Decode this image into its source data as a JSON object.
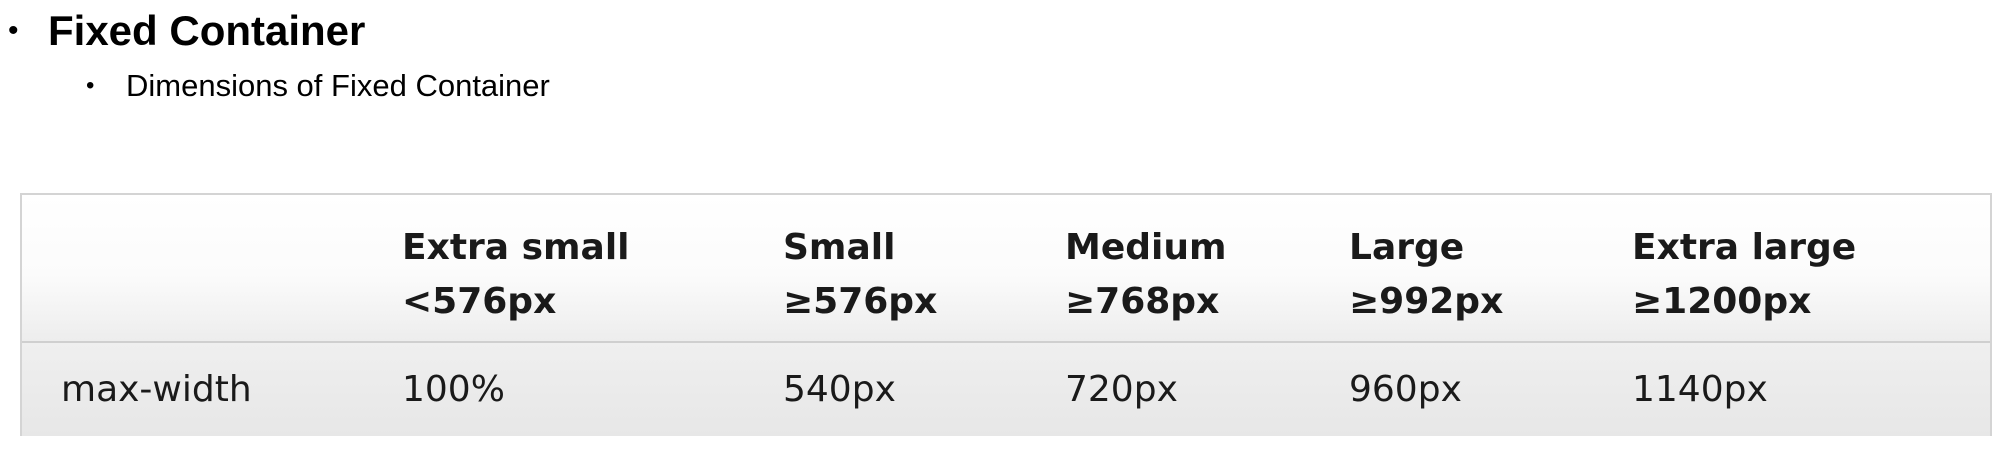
{
  "slide": {
    "heading": "Fixed Container",
    "subheading": "Dimensions of Fixed Container",
    "bullet": "•"
  },
  "table": {
    "columns": [
      {
        "title": "",
        "sub": ""
      },
      {
        "title": "Extra small",
        "sub": "<576px"
      },
      {
        "title": "Small",
        "sub": "≥576px"
      },
      {
        "title": "Medium",
        "sub": "≥768px"
      },
      {
        "title": "Large",
        "sub": "≥992px"
      },
      {
        "title": "Extra large",
        "sub": "≥1200px"
      }
    ],
    "rows": [
      {
        "label": "max-width",
        "values": [
          "100%",
          "540px",
          "720px",
          "960px",
          "1140px"
        ]
      }
    ]
  }
}
